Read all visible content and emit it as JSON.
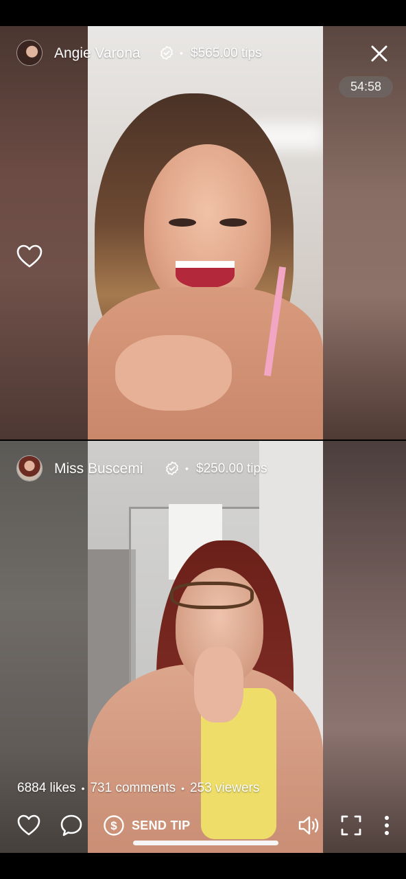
{
  "top_stream": {
    "host_name": "Angie Varona",
    "tips": "$565.00 tips",
    "separator": "•",
    "timer": "54:58"
  },
  "bottom_stream": {
    "host_name": "Miss Buscemi",
    "tips": "$250.00 tips",
    "separator": "•"
  },
  "stats": {
    "likes": "6884 likes",
    "comments": "731 comments",
    "viewers": "253 viewers",
    "separator": "•"
  },
  "actions": {
    "send_tip_label": "SEND TIP"
  },
  "icons": {
    "close": "close-icon",
    "heart": "heart-icon",
    "comment": "comment-icon",
    "dollar": "dollar-icon",
    "volume": "volume-icon",
    "fullscreen": "fullscreen-icon",
    "more": "more-vertical-icon",
    "verified": "verified-badge-icon"
  },
  "colors": {
    "background": "#000000",
    "text": "#ffffff",
    "timer_bg": "#6e6e6e"
  }
}
